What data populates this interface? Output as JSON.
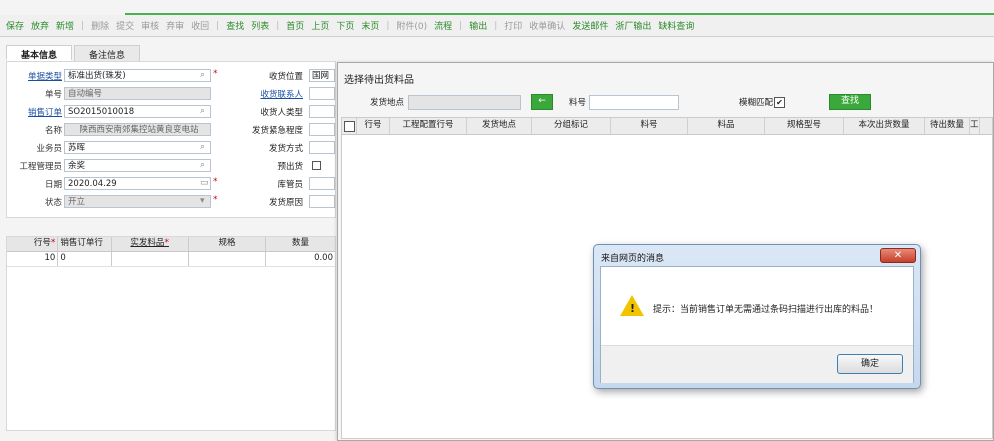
{
  "toolbar": [
    {
      "label": "保存",
      "enabled": true
    },
    {
      "label": "放弃",
      "enabled": true
    },
    {
      "label": "新增",
      "enabled": true
    },
    {
      "label": "删除",
      "enabled": false
    },
    {
      "label": "提交",
      "enabled": false
    },
    {
      "label": "审核",
      "enabled": false
    },
    {
      "label": "弃审",
      "enabled": false
    },
    {
      "label": "收回",
      "enabled": false
    },
    {
      "label": "查找",
      "enabled": true
    },
    {
      "label": "列表",
      "enabled": true
    },
    {
      "label": "首页",
      "enabled": true
    },
    {
      "label": "上页",
      "enabled": true
    },
    {
      "label": "下页",
      "enabled": true
    },
    {
      "label": "末页",
      "enabled": true
    },
    {
      "label": "附件(0)",
      "enabled": false
    },
    {
      "label": "流程",
      "enabled": true
    },
    {
      "label": "输出",
      "enabled": true
    },
    {
      "label": "打印",
      "enabled": false
    },
    {
      "label": "收单确认",
      "enabled": false
    },
    {
      "label": "发送邮件",
      "enabled": true
    },
    {
      "label": "浙厂输出",
      "enabled": true
    },
    {
      "label": "缺料查询",
      "enabled": true
    }
  ],
  "tabs": [
    "基本信息",
    "备注信息"
  ],
  "form_left": [
    {
      "label": "单据类型",
      "value": "标准出货(珠发)",
      "link": true,
      "readonly": false,
      "icon": "search-icon",
      "required": true
    },
    {
      "label": "单号",
      "value": "自动编号",
      "link": false,
      "readonly": true,
      "icon": "",
      "required": false
    },
    {
      "label": "销售订单",
      "value": "SO2015010018",
      "link": true,
      "readonly": false,
      "icon": "search-icon",
      "required": false
    },
    {
      "label": "名称",
      "value": "陕西西安南郊集控站黄良变电站",
      "link": false,
      "readonly": true,
      "icon": "",
      "required": false
    },
    {
      "label": "业务员",
      "value": "苏晖",
      "link": false,
      "readonly": false,
      "icon": "search-icon",
      "required": false
    },
    {
      "label": "工程管理员",
      "value": "余奖",
      "link": false,
      "readonly": false,
      "icon": "search-icon",
      "required": false
    },
    {
      "label": "日期",
      "value": "2020.04.29",
      "link": false,
      "readonly": false,
      "icon": "calendar-icon",
      "required": true
    },
    {
      "label": "状态",
      "value": "开立",
      "link": false,
      "readonly": true,
      "icon": "dropdown-icon",
      "required": true
    }
  ],
  "form_right": [
    {
      "label": "收货位置",
      "value": "国网陕",
      "link": false
    },
    {
      "label": "收货联系人",
      "value": "",
      "link": true
    },
    {
      "label": "收货人类型",
      "value": "",
      "link": false
    },
    {
      "label": "发货紧急程度",
      "value": "",
      "link": false
    },
    {
      "label": "发货方式",
      "value": "",
      "link": false
    },
    {
      "label": "预出货",
      "value": "",
      "link": false,
      "checkbox": true
    },
    {
      "label": "库管员",
      "value": "",
      "link": false
    },
    {
      "label": "发货原因",
      "value": "",
      "link": false
    }
  ],
  "grid": {
    "headers": [
      "行号",
      "销售订单行",
      "实发料品",
      "规格",
      "数量"
    ],
    "row": [
      "10",
      "0",
      "",
      "",
      "0.00"
    ]
  },
  "dialog": {
    "title": "选择待出货料品",
    "filter": {
      "location_label": "发货地点",
      "location_value": "",
      "arrow": "←",
      "item_label": "料号",
      "item_value": "",
      "fuzzy_label": "模糊匹配",
      "fuzzy_checked": "✔",
      "search_label": "查找"
    },
    "headers": [
      "行号",
      "工程配置行号",
      "发货地点",
      "分组标记",
      "料号",
      "料品",
      "规格型号",
      "本次出货数量",
      "待出数量",
      "工"
    ]
  },
  "message": {
    "title": "来自网页的消息",
    "close": "✕",
    "text": "提示：当前销售订单无需通过条码扫描进行出库的料品！",
    "ok": "确定"
  }
}
